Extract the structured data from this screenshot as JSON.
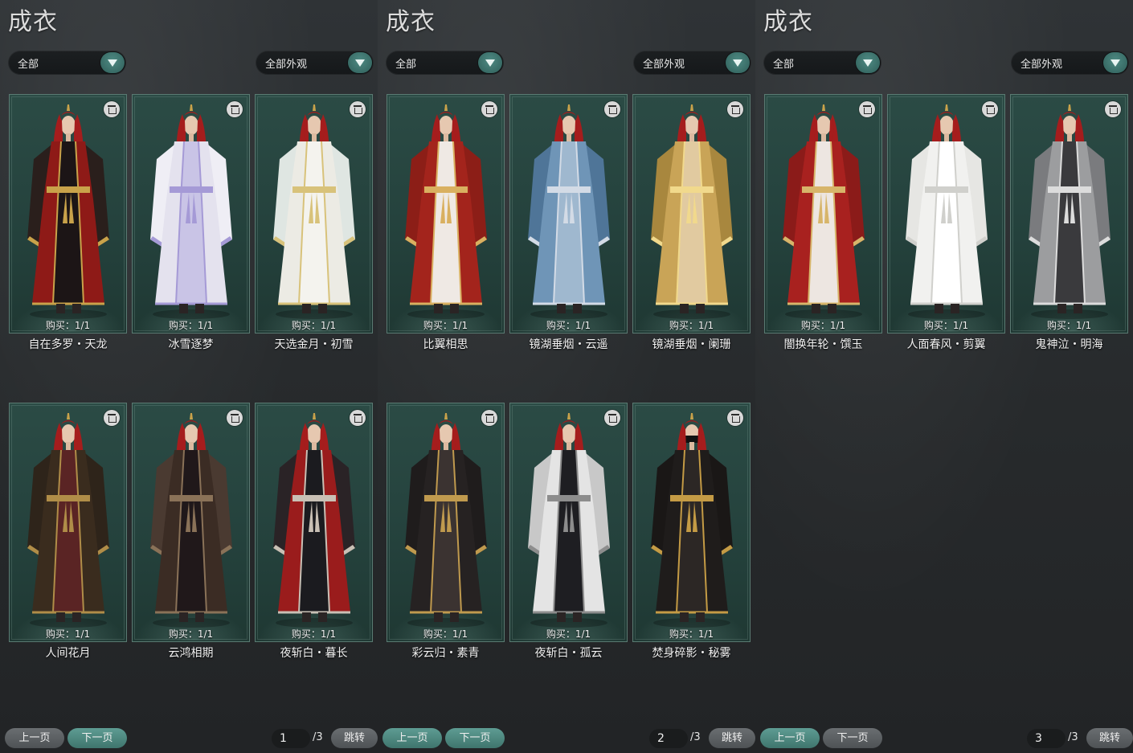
{
  "colors": {
    "card_bg": "#2b4b45",
    "accent_teal": "#5e9c93",
    "hair_red": "#a51d1d"
  },
  "panels": [
    {
      "title": "成衣",
      "filter_category": "全部",
      "filter_appearance": "全部外观",
      "items": [
        {
          "name": "自在多罗・天龙",
          "buy": "购买：1/1",
          "style": "red-black"
        },
        {
          "name": "冰雪逐梦",
          "buy": "购买：1/1",
          "style": "white-lilac"
        },
        {
          "name": "天选金月・初雪",
          "buy": "购买：1/1",
          "style": "white-gold"
        },
        {
          "name": "人间花月",
          "buy": "购买：1/1",
          "style": "brown-gold"
        },
        {
          "name": "云鸿相期",
          "buy": "购买：1/1",
          "style": "dark-brown"
        },
        {
          "name": "夜斩白・暮长",
          "buy": "购买：1/1",
          "style": "black-red"
        }
      ],
      "pager": {
        "prev": "上一页",
        "next": "下一页",
        "page": "1",
        "total": "/3",
        "jump": "跳转"
      }
    },
    {
      "title": "成衣",
      "filter_category": "全部",
      "filter_appearance": "全部外观",
      "items": [
        {
          "name": "比翼相思",
          "buy": "购买：1/1",
          "style": "red-white"
        },
        {
          "name": "镜湖垂烟・云遥",
          "buy": "购买：1/1",
          "style": "blue"
        },
        {
          "name": "镜湖垂烟・阑珊",
          "buy": "购买：1/1",
          "style": "gold"
        },
        {
          "name": "彩云归・素青",
          "buy": "购买：1/1",
          "style": "black-gold"
        },
        {
          "name": "夜斩白・孤云",
          "buy": "购买：1/1",
          "style": "white-black"
        },
        {
          "name": "焚身碎影・秘雾",
          "buy": "购买：1/1",
          "style": "black-gold-masked"
        }
      ],
      "pager": {
        "prev": "上一页",
        "next": "下一页",
        "page": "2",
        "total": "/3",
        "jump": "跳转"
      }
    },
    {
      "title": "成衣",
      "filter_category": "全部",
      "filter_appearance": "全部外观",
      "items": [
        {
          "name": "闇换年轮・馔玉",
          "buy": "购买：1/1",
          "style": "crimson"
        },
        {
          "name": "人面春风・剪翼",
          "buy": "购买：1/1",
          "style": "white"
        },
        {
          "name": "鬼神泣・明海",
          "buy": "购买：1/1",
          "style": "grey"
        }
      ],
      "pager": {
        "prev": "上一页",
        "next": "下一页",
        "page": "3",
        "total": "/3",
        "jump": "跳转"
      }
    }
  ]
}
